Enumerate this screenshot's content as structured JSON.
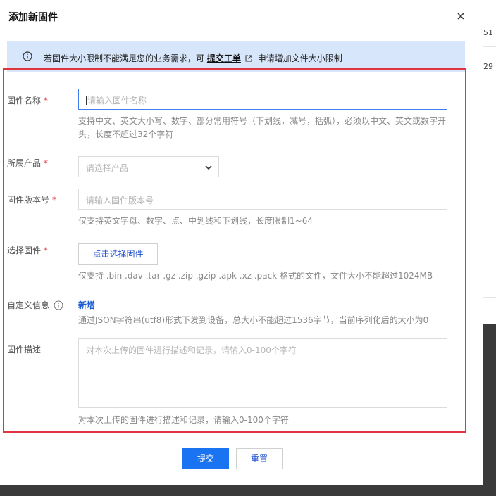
{
  "background": {
    "row1": "51",
    "row2": "29"
  },
  "dialog": {
    "title": "添加新固件",
    "close_icon": "close-icon"
  },
  "notice": {
    "icon": "info-icon",
    "text_before": "若固件大小限制不能满足您的业务需求，可",
    "link": "提交工单",
    "link_icon": "external-link-icon",
    "text_after": "申请增加文件大小限制"
  },
  "form": {
    "name": {
      "label": "固件名称",
      "required_mark": "*",
      "placeholder": "请输入固件名称",
      "hint": "支持中文、英文大小写、数字、部分常用符号（下划线，减号，括弧），必须以中文、英文或数字开头，长度不超过32个字符"
    },
    "product": {
      "label": "所属产品",
      "required_mark": "*",
      "placeholder": "请选择产品"
    },
    "version": {
      "label": "固件版本号",
      "required_mark": "*",
      "placeholder": "请输入固件版本号",
      "hint": "仅支持英文字母、数字、点、中划线和下划线，长度限制1~64"
    },
    "file": {
      "label": "选择固件",
      "required_mark": "*",
      "button": "点击选择固件",
      "hint": "仅支持 .bin .dav .tar .gz .zip .gzip .apk .xz .pack 格式的文件，文件大小不能超过1024MB"
    },
    "custom": {
      "label": "自定义信息",
      "help_icon": "help-icon",
      "add_link": "新增",
      "hint": "通过JSON字符串(utf8)形式下发到设备，总大小不能超过1536字节，当前序列化后的大小为0"
    },
    "description": {
      "label": "固件描述",
      "placeholder": "对本次上传的固件进行描述和记录，请输入0-100个字符",
      "hint": "对本次上传的固件进行描述和记录，请输入0-100个字符"
    }
  },
  "footer": {
    "submit": "提交",
    "reset": "重置"
  },
  "colors": {
    "primary": "#1a73f0",
    "notice_bg": "#d7e6fb",
    "required": "#e0343f",
    "highlight_frame": "#e0343f"
  }
}
